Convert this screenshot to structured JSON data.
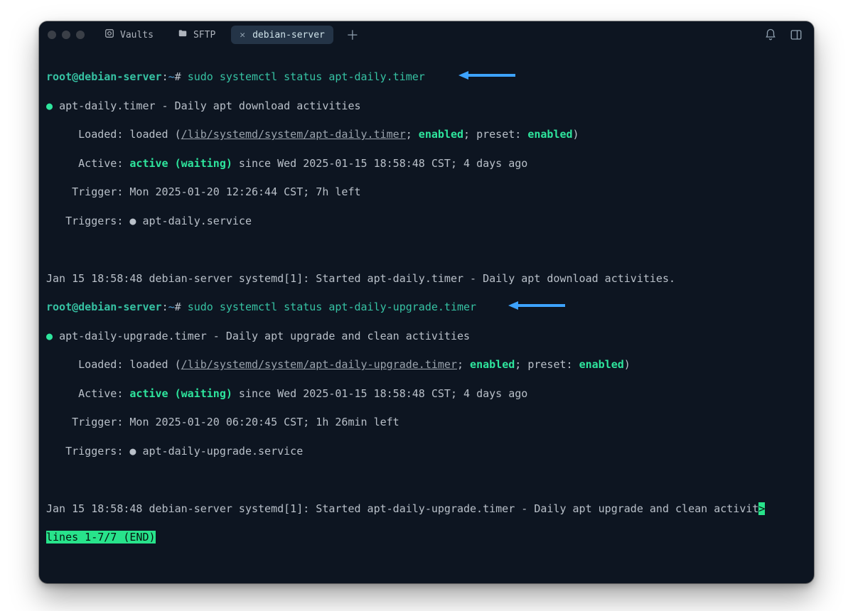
{
  "tabs": {
    "vaults": "Vaults",
    "sftp": "SFTP",
    "active": "debian-server"
  },
  "prompt": {
    "user": "root@debian-server",
    "sep": ":",
    "path": "~",
    "hash": "#"
  },
  "cmd1": "sudo systemctl status apt-daily.timer",
  "cmd2": "sudo systemctl status apt-daily-upgrade.timer",
  "block1": {
    "title": "apt-daily.timer - Daily apt download activities",
    "loaded_pre": "     Loaded: loaded (",
    "loaded_path": "/lib/systemd/system/apt-daily.timer",
    "loaded_mid1": "; ",
    "loaded_en": "enabled",
    "loaded_mid2": "; preset: ",
    "loaded_en2": "enabled",
    "loaded_post": ")",
    "active_pre": "     Active: ",
    "active_state": "active (waiting)",
    "active_post": " since Wed 2025-01-15 18:58:48 CST; 4 days ago",
    "trigger": "    Trigger: Mon 2025-01-20 12:26:44 CST; 7h left",
    "triggers": "   Triggers: ● apt-daily.service",
    "log": "Jan 15 18:58:48 debian-server systemd[1]: Started apt-daily.timer - Daily apt download activities."
  },
  "block2": {
    "title": "apt-daily-upgrade.timer - Daily apt upgrade and clean activities",
    "loaded_pre": "     Loaded: loaded (",
    "loaded_path": "/lib/systemd/system/apt-daily-upgrade.timer",
    "loaded_mid1": "; ",
    "loaded_en": "enabled",
    "loaded_mid2": "; preset: ",
    "loaded_en2": "enabled",
    "loaded_post": ")",
    "active_pre": "     Active: ",
    "active_state": "active (waiting)",
    "active_post": " since Wed 2025-01-15 18:58:48 CST; 4 days ago",
    "trigger": "    Trigger: Mon 2025-01-20 06:20:45 CST; 1h 26min left",
    "triggers": "   Triggers: ● apt-daily-upgrade.service",
    "log": "Jan 15 18:58:48 debian-server systemd[1]: Started apt-daily-upgrade.timer - Daily apt upgrade and clean activit",
    "log_more": ">"
  },
  "pager": "lines 1-7/7 (END)"
}
